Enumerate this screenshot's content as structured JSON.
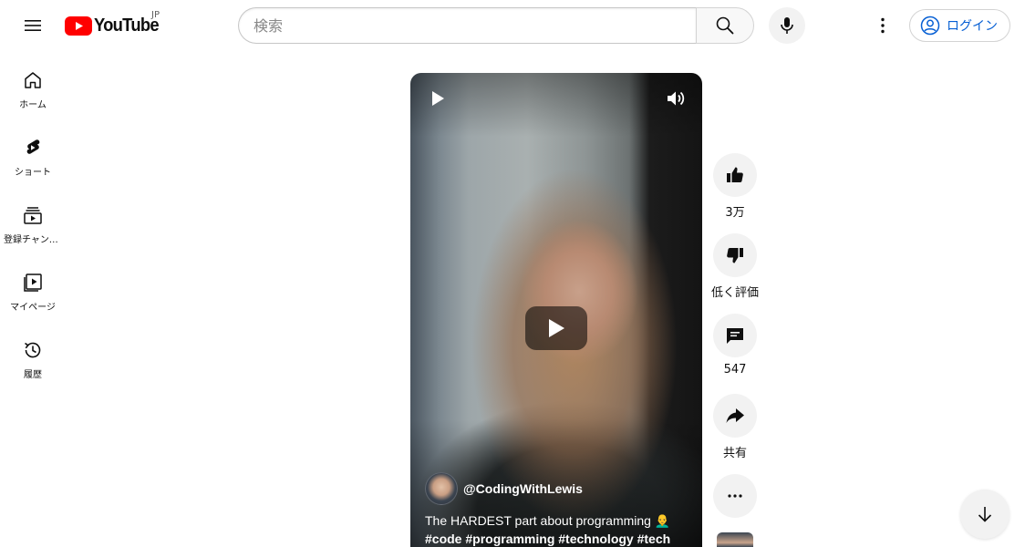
{
  "header": {
    "logo_text": "YouTube",
    "country_code": "JP",
    "search_placeholder": "検索",
    "login_label": "ログイン"
  },
  "sidebar": {
    "items": [
      {
        "label": "ホーム",
        "icon": "home-icon"
      },
      {
        "label": "ショート",
        "icon": "shorts-icon"
      },
      {
        "label": "登録チャンネル",
        "icon": "subscriptions-icon"
      },
      {
        "label": "マイページ",
        "icon": "library-icon"
      },
      {
        "label": "履歴",
        "icon": "history-icon"
      }
    ]
  },
  "short": {
    "channel_handle": "@CodingWithLewis",
    "caption_line1": "The HARDEST part about programming 👨‍🦲",
    "caption_line2": "#code #programming #technology #tech"
  },
  "actions": {
    "like_count": "3万",
    "dislike_label": "低く評価",
    "comment_count": "547",
    "share_label": "共有"
  },
  "colors": {
    "brand_red": "#ff0000",
    "link_blue": "#065fd4",
    "button_bg": "#f2f2f2"
  }
}
